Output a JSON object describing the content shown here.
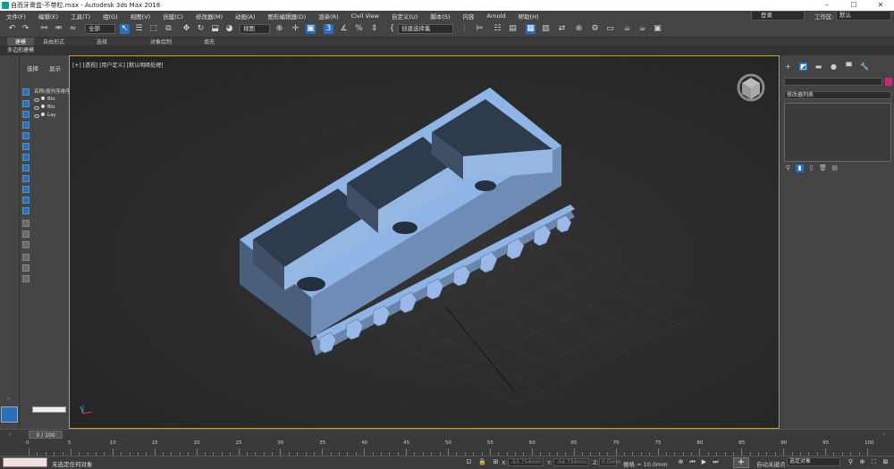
{
  "window": {
    "title": "自而牙膏盒-不带粒.max - Autodesk 3ds Max 2018",
    "min_icon": "minimize-icon",
    "max_icon": "maximize-icon",
    "close_icon": "close-icon"
  },
  "menu": [
    "文件(F)",
    "编辑(E)",
    "工具(T)",
    "组(G)",
    "视图(V)",
    "创建(C)",
    "修改器(M)",
    "动画(A)",
    "图形编辑器(D)",
    "渲染(R)",
    "Civil View",
    "自定义(U)",
    "脚本(S)",
    "内容",
    "Arnold",
    "帮助(H)"
  ],
  "account": {
    "signin": "登录",
    "workspace_label": "工作区:",
    "workspace_value": "默认"
  },
  "toolbar": {
    "filter_value": "全部",
    "view_value": "视图",
    "named_sel_value": "创建选择集"
  },
  "ribbon": {
    "tabs": [
      "建模",
      "自由形式",
      "选择",
      "对象绘制",
      "填充"
    ],
    "sub": "多边形建模"
  },
  "scene": {
    "tab_select": "选择",
    "tab_display": "显示",
    "header": "名称(按升序排序)",
    "items": [
      "Blo",
      "Blo",
      "Lay"
    ]
  },
  "viewport": {
    "label": "[+] [透视] [用户定义] [默认明暗处理]",
    "active_color": "#c9a227",
    "object_color": "#8fb4e6"
  },
  "command_panel": {
    "modifier_list": "修改器列表",
    "color_swatch": "#c8287a"
  },
  "timeline": {
    "frame": "0 / 100"
  },
  "ruler": {
    "labels": [
      "0",
      "5",
      "10",
      "15",
      "20",
      "25",
      "30",
      "35",
      "40",
      "45",
      "50",
      "55",
      "60",
      "65",
      "70",
      "75",
      "80",
      "85",
      "90",
      "95",
      "100"
    ]
  },
  "status": {
    "msg": "未选定任何对象",
    "x_label": "X:",
    "x_value": "-93.754mm",
    "y_label": "Y:",
    "y_value": "-94.734mm",
    "z_label": "Z:",
    "z_value": "0.0mm",
    "grid": "栅格 = 10.0mm",
    "autokey": "自动关键点",
    "selset": "选定对象",
    "setkey_label": "设置关键点"
  }
}
